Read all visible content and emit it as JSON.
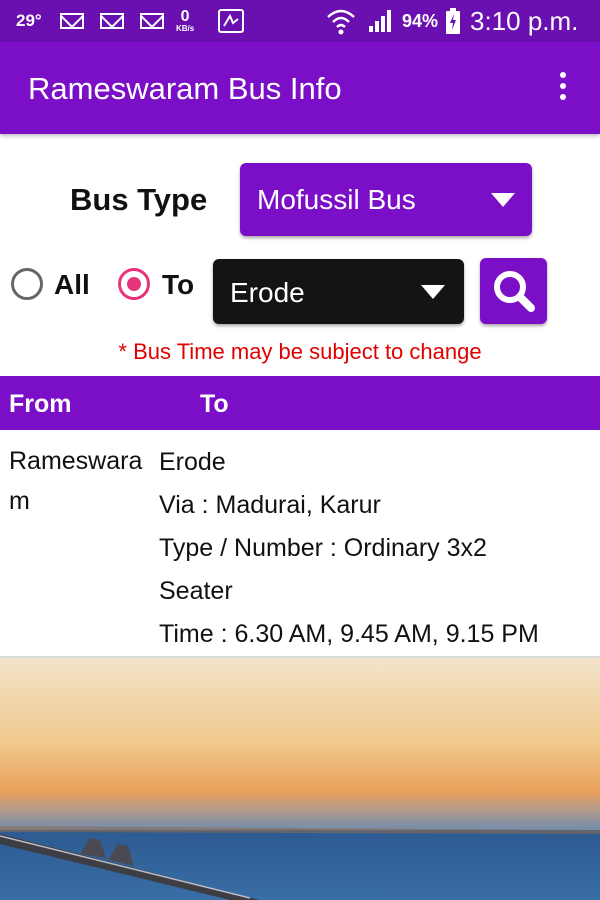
{
  "status_bar": {
    "temperature": "29°",
    "data_rate_value": "0",
    "data_rate_unit": "KB/s",
    "battery_percent": "94%",
    "time": "3:10 p.m.",
    "icons": [
      "mail-icon",
      "mail-icon",
      "mail-icon",
      "data-rate-icon",
      "app-notification-icon",
      "wifi-icon",
      "signal-icon",
      "battery-icon"
    ]
  },
  "app_bar": {
    "title": "Rameswaram Bus Info",
    "menu_icon": "more-vert-icon"
  },
  "form": {
    "bus_type_label": "Bus Type",
    "bus_type_value": "Mofussil Bus",
    "radio_all_label": "All",
    "radio_to_label": "To",
    "selected_radio": "To",
    "destination_value": "Erode",
    "search_icon": "search-icon"
  },
  "disclaimer": "* Bus Time may be subject to change",
  "table": {
    "headers": [
      "From",
      "To"
    ],
    "rows": [
      {
        "from": "Rameswaram",
        "to": "Erode",
        "via": "Via : Madurai, Karur",
        "type_line1": "Type / Number :  Ordinary 3x2",
        "type_line2": "Seater",
        "time": "Time : 6.30 AM, 9.45 AM, 9.15 PM"
      }
    ]
  },
  "colors": {
    "status_bar": "#6a0fb0",
    "primary": "#7b0fc7",
    "accent_radio": "#e6357a",
    "disclaimer_text": "#e00000",
    "dropdown_dark": "#141414"
  }
}
